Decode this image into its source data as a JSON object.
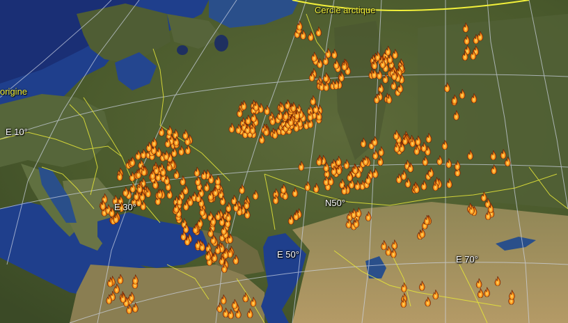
{
  "map": {
    "labels": {
      "arctic_circle": "Cercle arctique",
      "meridian_origin": "origine",
      "meridian_10": "E 10°",
      "meridian_30": "E 30°",
      "meridian_50": "E 50°",
      "meridian_70": "E 70°",
      "parallel_50": "N50°"
    },
    "colors": {
      "land_dark": "#3b4a26",
      "land_mid": "#5d6a3a",
      "land_light": "#9a8e5e",
      "desert": "#b49a66",
      "sea": "#1f3f8c",
      "deep_sea": "#1a2f75",
      "border": "#e8e838",
      "graticule": "#cfd6e6",
      "fire_outer": "#b23a08",
      "fire_inner": "#ff9a1a",
      "fire_core": "#ffe070"
    },
    "marker_icon": "fire-icon"
  }
}
